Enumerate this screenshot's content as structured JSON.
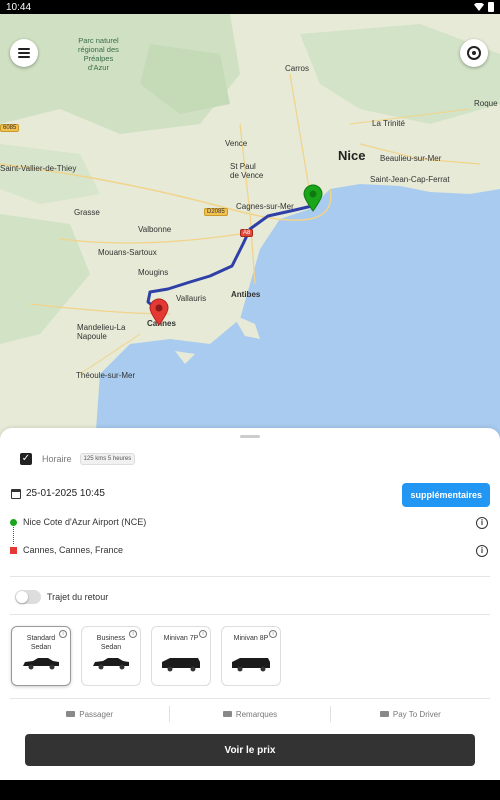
{
  "status": {
    "time": "10:44"
  },
  "map": {
    "labels": {
      "park": "Parc naturel\nrégional des\nPréalpes\nd'Azur",
      "nice": "Nice",
      "cannes": "Cannes",
      "antibes": "Antibes",
      "vallauris": "Vallauris",
      "mougins": "Mougins",
      "mouans": "Mouans-Sartoux",
      "valbonne": "Valbonne",
      "grasse": "Grasse",
      "vence": "Vence",
      "stpaul": "St Paul\nde Vence",
      "cagnes": "Cagnes-sur-Mer",
      "mandelieu": "Mandelieu-La\nNapoule",
      "theoule": "Théoule-sur-Mer",
      "latrinite": "La Trinité",
      "beaulieu": "Beaulieu-sur-Mer",
      "stjean": "Saint-Jean-Cap-Ferrat",
      "carros": "Carros",
      "roque": "Roque",
      "cabris": "Saint-Vallier-de-Thiey",
      "d6085": "6085",
      "d2085": "D2085",
      "a8": "A8"
    }
  },
  "sheet": {
    "horaire_label": "Horaire",
    "horaire_chip": "125 kms 5 heures",
    "date": "25-01-2025 10:45",
    "supp_button": "supplémentaires",
    "stop_a": "Nice Cote d'Azur Airport (NCE)",
    "stop_b": "Cannes, Cannes, France",
    "retour_label": "Trajet du retour",
    "vehicles": [
      {
        "name": "Standard\nSedan"
      },
      {
        "name": "Business\nSedan"
      },
      {
        "name": "Minivan 7P"
      },
      {
        "name": "Minivan 8P"
      }
    ],
    "bottom": {
      "passager": "Passager",
      "remarques": "Remarques",
      "pay": "Pay To Driver"
    },
    "main_button": "Voir le prix"
  },
  "colors": {
    "accent": "#2196f3",
    "route": "#2f3fa8",
    "start_marker": "#1aa51a",
    "end_marker": "#e53935"
  }
}
